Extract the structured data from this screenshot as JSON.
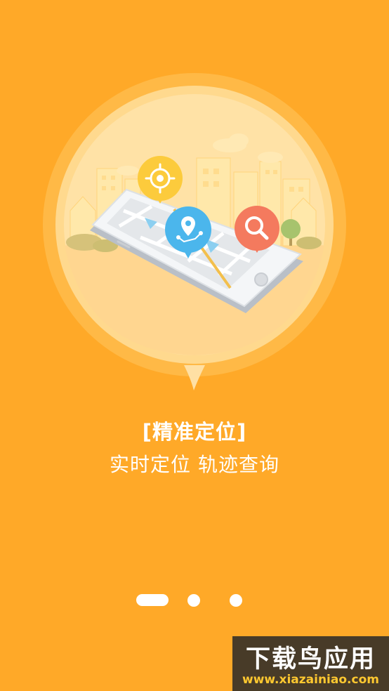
{
  "onboarding": {
    "title": "[精准定位]",
    "subtitle": "实时定位 轨迹查询",
    "page_indicator": {
      "total": 3,
      "current": 1
    }
  },
  "watermark": {
    "title": "下载鸟应用",
    "url": "www.xiazainiao.com"
  },
  "icons": [
    "crosshair-icon",
    "location-pin-icon",
    "search-icon"
  ],
  "colors": {
    "background": "#FFA928",
    "locate_bubble": "#FCCB3C",
    "pin_bubble": "#4BB6EC",
    "search_bubble": "#F47A5E"
  }
}
